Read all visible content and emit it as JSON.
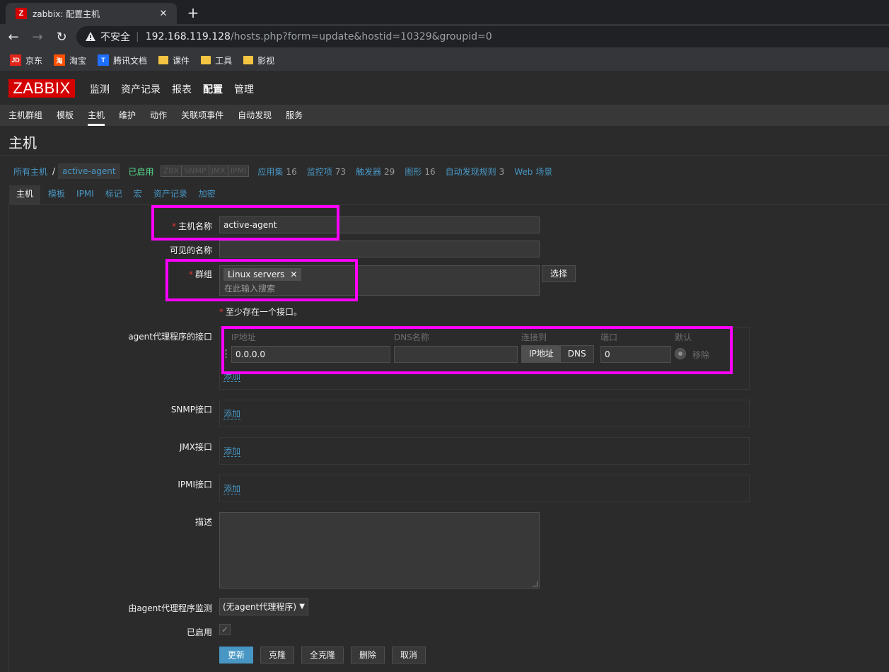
{
  "browser": {
    "tab_title": "zabbix: 配置主机",
    "tab_favicon_letter": "Z",
    "address_insecure": "不安全",
    "url_host": "192.168.119.128",
    "url_path": "/hosts.php?form=update&hostid=10329&groupid=0",
    "bookmarks": [
      {
        "label": "京东",
        "icon": "jd-icon",
        "badge": "JD",
        "color": "#e1251b"
      },
      {
        "label": "淘宝",
        "icon": "taobao-icon",
        "badge": "淘",
        "color": "#ff5000"
      },
      {
        "label": "腾讯文档",
        "icon": "tencent-docs-icon",
        "badge": "T",
        "color": "#1e6fff"
      },
      {
        "label": "课件",
        "icon": "folder-icon",
        "badge": "",
        "color": "#f4c542"
      },
      {
        "label": "工具",
        "icon": "folder-icon",
        "badge": "",
        "color": "#f4c542"
      },
      {
        "label": "影视",
        "icon": "folder-icon",
        "badge": "",
        "color": "#f4c542"
      }
    ]
  },
  "header": {
    "logo": "ZABBIX",
    "main_nav": [
      "监测",
      "资产记录",
      "报表",
      "配置",
      "管理"
    ],
    "active_main": "配置",
    "sub_nav": [
      "主机群组",
      "模板",
      "主机",
      "维护",
      "动作",
      "关联项事件",
      "自动发现",
      "服务"
    ],
    "active_sub": "主机"
  },
  "page": {
    "title": "主机",
    "breadcrumb": {
      "all_hosts": "所有主机",
      "sep": "/",
      "current": "active-agent",
      "status": "已启用",
      "availability": [
        "ZBX",
        "SNMP",
        "JMX",
        "IPMI"
      ],
      "items": [
        {
          "label": "应用集",
          "count": "16"
        },
        {
          "label": "监控项",
          "count": "73"
        },
        {
          "label": "触发器",
          "count": "29"
        },
        {
          "label": "图形",
          "count": "16"
        },
        {
          "label": "自动发现规则",
          "count": "3"
        },
        {
          "label": "Web 场景",
          "count": ""
        }
      ]
    },
    "form_tabs": [
      "主机",
      "模板",
      "IPMI",
      "标记",
      "宏",
      "资产记录",
      "加密"
    ]
  },
  "form": {
    "host_name_label": "主机名称",
    "host_name_value": "active-agent",
    "visible_name_label": "可见的名称",
    "visible_name_value": "",
    "groups_label": "群组",
    "groups_chip": "Linux servers",
    "groups_placeholder": "在此输入搜索",
    "select_button": "选择",
    "required_mark": "*",
    "interface_note": "至少存在一个接口。",
    "agent_iface_label": "agent代理程序的接口",
    "iface_headers": {
      "ip": "IP地址",
      "dns": "DNS名称",
      "connect": "连接到",
      "port": "端口",
      "default": "默认"
    },
    "iface_ip_value": "0.0.0.0",
    "iface_dns_value": "",
    "connect_ip": "IP地址",
    "connect_dns": "DNS",
    "iface_port_value": "0",
    "remove": "移除",
    "add": "添加",
    "snmp_label": "SNMP接口",
    "jmx_label": "JMX接口",
    "ipmi_label": "IPMI接口",
    "description_label": "描述",
    "proxy_label": "由agent代理程序监测",
    "proxy_value": "(无agent代理程序)",
    "enabled_label": "已启用",
    "enabled_checked": true,
    "buttons": {
      "update": "更新",
      "clone": "克隆",
      "full_clone": "全克隆",
      "delete": "删除",
      "cancel": "取消"
    }
  },
  "colors": {
    "highlight": "#ff00ff",
    "link": "#4796c4",
    "brand": "#d40000",
    "enabled": "#59db8f"
  }
}
